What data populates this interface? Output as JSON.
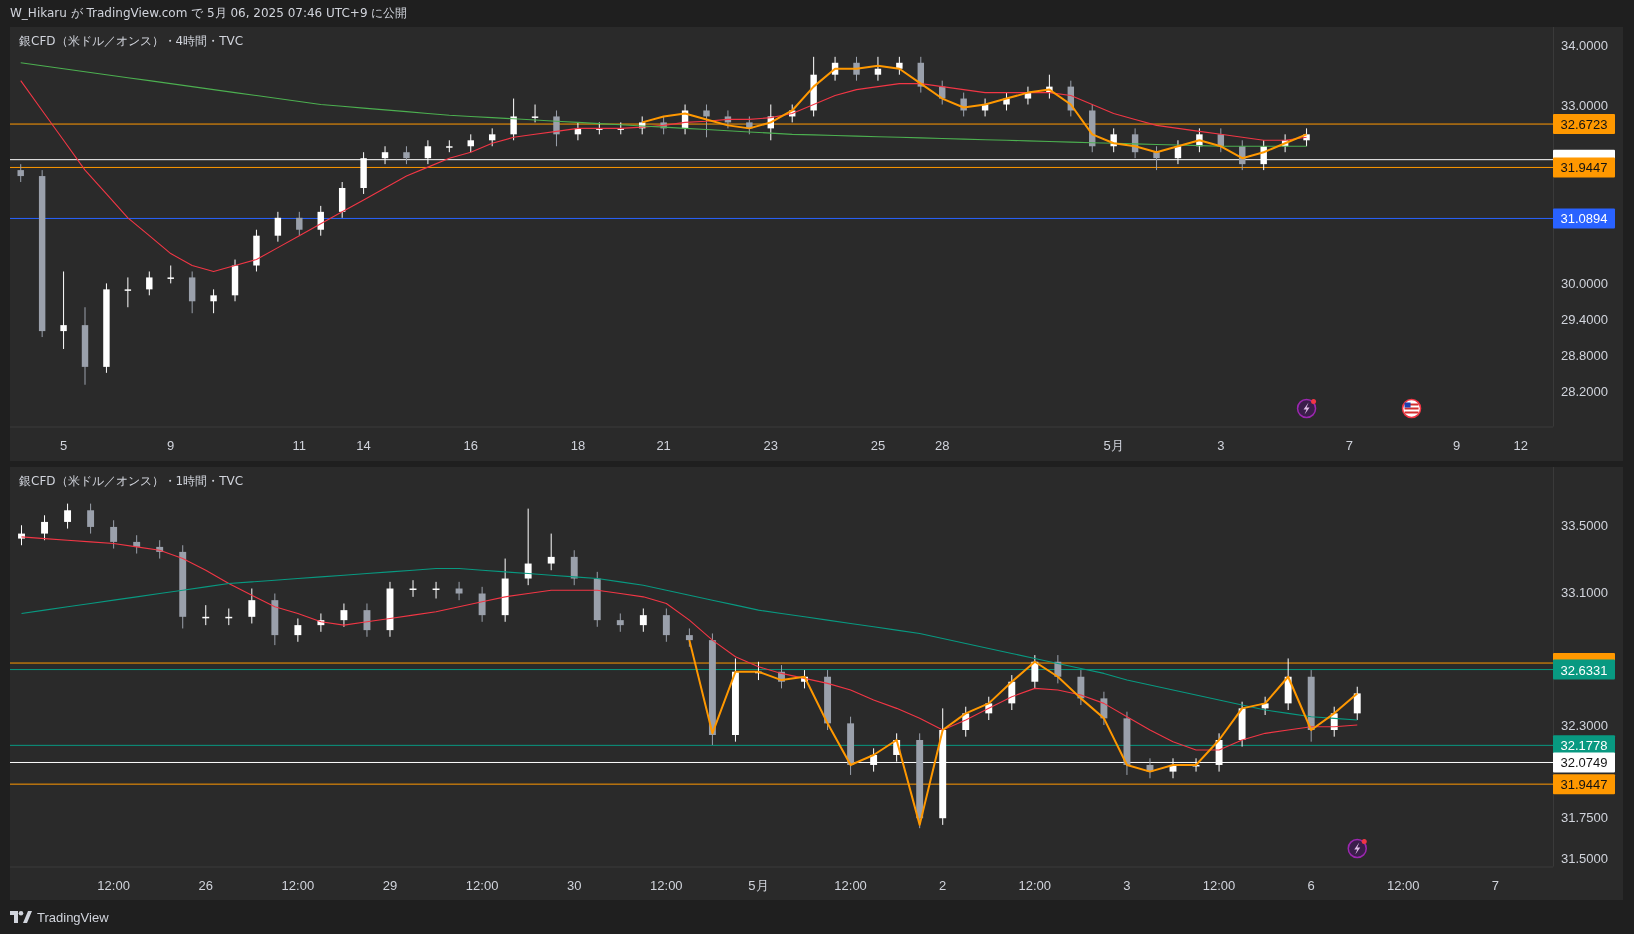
{
  "header": {
    "text": "W_Hikaru が TradingView.com で 5月 06, 2025 07:46 UTC+9 に公開"
  },
  "panels": [
    {
      "title": "銀CFD（米ドル／オンス）・4時間・TVC",
      "events": [
        {
          "kind": "lightning"
        },
        {
          "kind": "flag"
        }
      ],
      "chart_data": {
        "type": "candlestick",
        "categories": [
          null,
          null,
          "5",
          null,
          null,
          null,
          null,
          "9",
          null,
          null,
          null,
          null,
          null,
          "11",
          null,
          null,
          "14",
          null,
          null,
          null,
          null,
          "16",
          null,
          null,
          null,
          null,
          "18",
          null,
          null,
          null,
          "21",
          null,
          null,
          null,
          null,
          "23",
          null,
          null,
          null,
          null,
          "25",
          null,
          null,
          "28",
          null,
          null,
          null,
          null,
          null,
          null,
          null,
          "5月",
          null,
          null,
          null,
          null,
          "3",
          null,
          null,
          null,
          null,
          null,
          "7",
          null,
          null,
          null,
          null,
          "9",
          null,
          null,
          "12",
          null
        ],
        "ylim": [
          27.6,
          34.3
        ],
        "yticks": [
          {
            "value": 34,
            "label": "34.0000"
          },
          {
            "value": 33,
            "label": "33.0000"
          },
          {
            "value": 30,
            "label": "30.0000"
          },
          {
            "value": 29.4,
            "label": "29.4000"
          },
          {
            "value": 28.8,
            "label": "28.8000"
          },
          {
            "value": 28.2,
            "label": "28.2000"
          }
        ],
        "ohlc": [
          [
            31.9,
            32.0,
            31.7,
            31.8
          ],
          [
            31.8,
            31.9,
            29.1,
            29.2
          ],
          [
            29.2,
            30.2,
            28.9,
            29.3
          ],
          [
            29.3,
            29.6,
            28.3,
            28.6
          ],
          [
            28.6,
            30.0,
            28.5,
            29.9
          ],
          [
            29.9,
            30.1,
            29.6,
            29.9
          ],
          [
            29.9,
            30.2,
            29.8,
            30.1
          ],
          [
            30.1,
            30.3,
            30.0,
            30.1
          ],
          [
            30.1,
            30.2,
            29.5,
            29.7
          ],
          [
            29.7,
            29.9,
            29.5,
            29.8
          ],
          [
            29.8,
            30.4,
            29.7,
            30.3
          ],
          [
            30.3,
            30.9,
            30.2,
            30.8
          ],
          [
            30.8,
            31.2,
            30.7,
            31.1
          ],
          [
            31.1,
            31.2,
            30.8,
            30.9
          ],
          [
            30.9,
            31.3,
            30.8,
            31.2
          ],
          [
            31.2,
            31.7,
            31.1,
            31.6
          ],
          [
            31.6,
            32.2,
            31.5,
            32.1
          ],
          [
            32.1,
            32.3,
            32.0,
            32.2
          ],
          [
            32.2,
            32.3,
            32.0,
            32.1
          ],
          [
            32.1,
            32.4,
            32.0,
            32.3
          ],
          [
            32.3,
            32.4,
            32.2,
            32.3
          ],
          [
            32.3,
            32.5,
            32.2,
            32.4
          ],
          [
            32.4,
            32.6,
            32.3,
            32.5
          ],
          [
            32.5,
            33.1,
            32.4,
            32.8
          ],
          [
            32.8,
            33.0,
            32.7,
            32.8
          ],
          [
            32.8,
            32.9,
            32.3,
            32.5
          ],
          [
            32.5,
            32.7,
            32.4,
            32.6
          ],
          [
            32.6,
            32.7,
            32.5,
            32.6
          ],
          [
            32.6,
            32.7,
            32.5,
            32.6
          ],
          [
            32.6,
            32.8,
            32.5,
            32.7
          ],
          [
            32.7,
            32.8,
            32.5,
            32.6
          ],
          [
            32.6,
            33.0,
            32.5,
            32.9
          ],
          [
            32.9,
            33.0,
            32.45,
            32.8
          ],
          [
            32.8,
            32.9,
            32.6,
            32.7
          ],
          [
            32.7,
            32.8,
            32.5,
            32.6
          ],
          [
            32.6,
            33.0,
            32.4,
            32.8
          ],
          [
            32.8,
            33.0,
            32.7,
            32.9
          ],
          [
            32.9,
            33.8,
            32.8,
            33.5
          ],
          [
            33.5,
            33.8,
            33.4,
            33.7
          ],
          [
            33.7,
            33.8,
            33.4,
            33.5
          ],
          [
            33.5,
            33.8,
            33.4,
            33.6
          ],
          [
            33.6,
            33.8,
            33.5,
            33.7
          ],
          [
            33.7,
            33.8,
            33.2,
            33.3
          ],
          [
            33.3,
            33.4,
            33.0,
            33.1
          ],
          [
            33.1,
            33.2,
            32.8,
            32.9
          ],
          [
            32.9,
            33.1,
            32.8,
            33.0
          ],
          [
            33.0,
            33.2,
            32.9,
            33.1
          ],
          [
            33.1,
            33.3,
            33.0,
            33.2
          ],
          [
            33.2,
            33.5,
            33.1,
            33.3
          ],
          [
            33.3,
            33.4,
            32.8,
            32.9
          ],
          [
            32.9,
            33.0,
            32.2,
            32.3
          ],
          [
            32.3,
            32.6,
            32.2,
            32.5
          ],
          [
            32.5,
            32.6,
            32.1,
            32.2
          ],
          [
            32.2,
            32.3,
            31.9,
            32.1
          ],
          [
            32.1,
            32.4,
            32.0,
            32.3
          ],
          [
            32.3,
            32.6,
            32.2,
            32.5
          ],
          [
            32.5,
            32.6,
            32.2,
            32.3
          ],
          [
            32.3,
            32.4,
            31.9,
            32.0
          ],
          [
            32.0,
            32.4,
            31.9,
            32.3
          ],
          [
            32.3,
            32.5,
            32.2,
            32.4
          ],
          [
            32.4,
            32.6,
            32.3,
            32.5
          ],
          null,
          null,
          null,
          null,
          null,
          null,
          null,
          null,
          null,
          null,
          null
        ],
        "series": [
          {
            "type": "line",
            "color": "#f23645",
            "values": [
              33.4,
              32.9,
              32.4,
              31.9,
              31.5,
              31.1,
              30.8,
              30.5,
              30.3,
              30.2,
              30.3,
              30.4,
              30.6,
              30.8,
              31.0,
              31.2,
              31.4,
              31.6,
              31.8,
              31.95,
              32.1,
              32.2,
              32.35,
              32.45,
              32.5,
              32.55,
              32.6,
              32.6,
              32.6,
              32.62,
              32.65,
              32.7,
              32.72,
              32.75,
              32.75,
              32.78,
              32.85,
              33.0,
              33.15,
              33.25,
              33.3,
              33.35,
              33.35,
              33.3,
              33.25,
              33.2,
              33.2,
              33.2,
              33.2,
              33.15,
              33.0,
              32.85,
              32.75,
              32.65,
              32.6,
              32.55,
              32.5,
              32.45,
              32.4,
              32.4,
              32.45,
              null,
              null,
              null,
              null,
              null,
              null,
              null,
              null,
              null,
              null,
              null
            ]
          },
          {
            "type": "line",
            "color": "#4caf50",
            "values": [
              33.7,
              33.65,
              33.6,
              33.55,
              33.5,
              33.45,
              33.4,
              33.35,
              33.3,
              33.25,
              33.2,
              33.15,
              33.1,
              33.05,
              33.0,
              32.97,
              32.94,
              32.91,
              32.88,
              32.85,
              32.82,
              32.8,
              32.78,
              32.76,
              32.74,
              32.72,
              32.7,
              32.68,
              32.66,
              32.64,
              32.62,
              32.6,
              32.58,
              32.56,
              32.54,
              32.52,
              32.5,
              32.49,
              32.48,
              32.47,
              32.46,
              32.45,
              32.44,
              32.43,
              32.42,
              32.41,
              32.4,
              32.39,
              32.38,
              32.37,
              32.36,
              32.35,
              32.34,
              32.33,
              32.32,
              32.31,
              32.3,
              32.3,
              32.3,
              32.3,
              32.3,
              null,
              null,
              null,
              null,
              null,
              null,
              null,
              null,
              null,
              null,
              null
            ]
          },
          {
            "type": "line",
            "color": "#ff9800",
            "values": [
              null,
              null,
              null,
              null,
              null,
              null,
              null,
              null,
              null,
              null,
              null,
              null,
              null,
              null,
              null,
              null,
              null,
              null,
              null,
              null,
              null,
              null,
              null,
              null,
              null,
              null,
              null,
              null,
              null,
              32.7,
              32.8,
              32.85,
              32.75,
              32.65,
              32.6,
              32.7,
              32.9,
              33.3,
              33.6,
              33.6,
              33.65,
              33.6,
              33.35,
              33.1,
              32.95,
              33.0,
              33.1,
              33.2,
              33.25,
              33.0,
              32.5,
              32.35,
              32.3,
              32.2,
              32.3,
              32.4,
              32.3,
              32.1,
              32.2,
              32.35,
              32.5,
              null,
              null,
              null,
              null,
              null,
              null,
              null,
              null,
              null,
              null,
              null
            ]
          }
        ],
        "ref_lines": [
          {
            "axis": "y",
            "value": 32.6723,
            "label": "32.6723",
            "color": "#ff9800"
          },
          {
            "axis": "y",
            "value": 32.0749,
            "color": "#ffffff"
          },
          {
            "axis": "y",
            "value": 31.9447,
            "label": "31.9447",
            "color": "#ff9800"
          },
          {
            "axis": "y",
            "value": 31.0894,
            "label": "31.0894",
            "color": "#2962ff"
          }
        ]
      }
    },
    {
      "title": "銀CFD（米ドル／オンス）・1時間・TVC",
      "events": [
        {
          "kind": "lightning"
        }
      ],
      "chart_data": {
        "type": "candlestick",
        "categories": [
          null,
          null,
          null,
          null,
          "12:00",
          null,
          null,
          null,
          "26",
          null,
          null,
          null,
          "12:00",
          null,
          null,
          null,
          "29",
          null,
          null,
          null,
          "12:00",
          null,
          null,
          null,
          "30",
          null,
          null,
          null,
          "12:00",
          null,
          null,
          null,
          "5月",
          null,
          null,
          null,
          "12:00",
          null,
          null,
          null,
          "2",
          null,
          null,
          null,
          "12:00",
          null,
          null,
          null,
          "3",
          null,
          null,
          null,
          "12:00",
          null,
          null,
          null,
          "6",
          null,
          null,
          null,
          "12:00",
          null,
          null,
          null,
          "7",
          null,
          null
        ],
        "ylim": [
          31.45,
          33.85
        ],
        "yticks": [
          {
            "value": 33.5,
            "label": "33.5000"
          },
          {
            "value": 33.1,
            "label": "33.1000"
          },
          {
            "value": 32.3,
            "label": "32.3000"
          },
          {
            "value": 31.75,
            "label": "31.7500"
          },
          {
            "value": 31.5,
            "label": "31.5000"
          }
        ],
        "ohlc": [
          [
            33.42,
            33.5,
            33.38,
            33.45
          ],
          [
            33.45,
            33.56,
            33.41,
            33.52
          ],
          [
            33.52,
            33.63,
            33.48,
            33.59
          ],
          [
            33.59,
            33.63,
            33.45,
            33.49
          ],
          [
            33.49,
            33.53,
            33.36,
            33.4
          ],
          [
            33.4,
            33.44,
            33.33,
            33.37
          ],
          [
            33.37,
            33.41,
            33.3,
            33.34
          ],
          [
            33.34,
            33.38,
            32.88,
            32.95
          ],
          [
            32.95,
            33.02,
            32.9,
            32.95
          ],
          [
            32.95,
            33.0,
            32.9,
            32.95
          ],
          [
            32.95,
            33.12,
            32.91,
            33.05
          ],
          [
            33.05,
            33.09,
            32.78,
            32.84
          ],
          [
            32.84,
            32.94,
            32.8,
            32.9
          ],
          [
            32.9,
            32.97,
            32.86,
            32.93
          ],
          [
            32.93,
            33.03,
            32.89,
            32.99
          ],
          [
            32.99,
            33.03,
            32.83,
            32.87
          ],
          [
            32.87,
            33.16,
            32.83,
            33.12
          ],
          [
            33.12,
            33.17,
            33.07,
            33.12
          ],
          [
            33.12,
            33.16,
            33.06,
            33.12
          ],
          [
            33.12,
            33.16,
            33.05,
            33.09
          ],
          [
            33.09,
            33.13,
            32.92,
            32.96
          ],
          [
            32.96,
            33.3,
            32.92,
            33.18
          ],
          [
            33.18,
            33.6,
            33.14,
            33.27
          ],
          [
            33.27,
            33.45,
            33.23,
            33.31
          ],
          [
            33.31,
            33.35,
            33.14,
            33.18
          ],
          [
            33.18,
            33.22,
            32.89,
            32.93
          ],
          [
            32.93,
            32.97,
            32.86,
            32.9
          ],
          [
            32.9,
            33.0,
            32.86,
            32.96
          ],
          [
            32.96,
            33.0,
            32.8,
            32.84
          ],
          [
            32.84,
            32.88,
            32.77,
            32.81
          ],
          [
            32.81,
            32.85,
            32.18,
            32.24
          ],
          [
            32.24,
            32.7,
            32.2,
            32.62
          ],
          [
            32.62,
            32.68,
            32.57,
            32.62
          ],
          [
            32.62,
            32.66,
            32.52,
            32.56
          ],
          [
            32.56,
            32.63,
            32.52,
            32.59
          ],
          [
            32.59,
            32.63,
            32.27,
            32.31
          ],
          [
            32.31,
            32.35,
            32.0,
            32.06
          ],
          [
            32.06,
            32.16,
            32.02,
            32.12
          ],
          [
            32.12,
            32.25,
            32.08,
            32.21
          ],
          [
            32.21,
            32.25,
            31.68,
            31.74
          ],
          [
            31.74,
            32.4,
            31.7,
            32.27
          ],
          [
            32.27,
            32.41,
            32.23,
            32.37
          ],
          [
            32.37,
            32.47,
            32.33,
            32.43
          ],
          [
            32.43,
            32.6,
            32.39,
            32.56
          ],
          [
            32.56,
            32.72,
            32.52,
            32.68
          ],
          [
            32.68,
            32.72,
            32.55,
            32.59
          ],
          [
            32.59,
            32.63,
            32.42,
            32.46
          ],
          [
            32.46,
            32.5,
            32.3,
            32.34
          ],
          [
            32.34,
            32.38,
            32.0,
            32.06
          ],
          [
            32.06,
            32.1,
            31.98,
            32.02
          ],
          [
            32.02,
            32.1,
            31.98,
            32.06
          ],
          [
            32.06,
            32.1,
            32.02,
            32.06
          ],
          [
            32.06,
            32.25,
            32.02,
            32.21
          ],
          [
            32.21,
            32.44,
            32.17,
            32.4
          ],
          [
            32.4,
            32.47,
            32.36,
            32.43
          ],
          [
            32.43,
            32.7,
            32.39,
            32.59
          ],
          [
            32.59,
            32.63,
            32.2,
            32.27
          ],
          [
            32.27,
            32.41,
            32.23,
            32.37
          ],
          [
            32.37,
            32.53,
            32.33,
            32.49
          ],
          null,
          null,
          null,
          null,
          null,
          null,
          null,
          null
        ],
        "series": [
          {
            "type": "line",
            "color": "#f23645",
            "values": [
              33.43,
              33.42,
              33.41,
              33.4,
              33.39,
              33.37,
              33.35,
              33.3,
              33.23,
              33.15,
              33.08,
              33.01,
              32.97,
              32.92,
              32.9,
              32.92,
              32.94,
              32.96,
              32.98,
              33.01,
              33.04,
              33.07,
              33.09,
              33.11,
              33.11,
              33.11,
              33.09,
              33.07,
              33.03,
              32.93,
              32.81,
              32.71,
              32.65,
              32.61,
              32.58,
              32.55,
              32.51,
              32.45,
              32.4,
              32.34,
              32.27,
              32.33,
              32.4,
              32.47,
              32.52,
              32.51,
              32.48,
              32.43,
              32.35,
              32.27,
              32.2,
              32.15,
              32.15,
              32.21,
              32.25,
              32.27,
              32.29,
              32.29,
              32.3,
              null,
              null,
              null,
              null,
              null,
              null,
              null,
              null
            ]
          },
          {
            "type": "line",
            "color": "#089981",
            "values": [
              32.97,
              32.99,
              33.01,
              33.03,
              33.05,
              33.07,
              33.09,
              33.11,
              33.13,
              33.15,
              33.16,
              33.17,
              33.18,
              33.19,
              33.2,
              33.21,
              33.22,
              33.23,
              33.24,
              33.24,
              33.23,
              33.22,
              33.21,
              33.2,
              33.19,
              33.18,
              33.16,
              33.14,
              33.11,
              33.08,
              33.05,
              33.02,
              32.99,
              32.97,
              32.95,
              32.93,
              32.91,
              32.89,
              32.87,
              32.85,
              32.82,
              32.79,
              32.76,
              32.73,
              32.7,
              32.67,
              32.64,
              32.61,
              32.57,
              32.54,
              32.51,
              32.48,
              32.45,
              32.42,
              32.39,
              32.37,
              32.35,
              32.34,
              32.33,
              null,
              null,
              null,
              null,
              null,
              null,
              null,
              null
            ]
          },
          {
            "type": "line",
            "color": "#ff9800",
            "values": [
              null,
              null,
              null,
              null,
              null,
              null,
              null,
              null,
              null,
              null,
              null,
              null,
              null,
              null,
              null,
              null,
              null,
              null,
              null,
              null,
              null,
              null,
              null,
              null,
              null,
              null,
              null,
              null,
              null,
              32.81,
              32.25,
              32.62,
              32.62,
              32.57,
              32.59,
              32.31,
              32.06,
              32.12,
              32.21,
              31.7,
              32.27,
              32.37,
              32.43,
              32.56,
              32.68,
              32.59,
              32.46,
              32.34,
              32.06,
              32.02,
              32.06,
              32.06,
              32.21,
              32.4,
              32.43,
              32.59,
              32.27,
              32.37,
              32.49,
              null,
              null,
              null,
              null,
              null,
              null,
              null,
              null
            ]
          }
        ],
        "ref_lines": [
          {
            "axis": "y",
            "value": 32.6723,
            "color": "#ff9800"
          },
          {
            "axis": "y",
            "value": 32.6331,
            "label": "32.6331",
            "color": "#089981"
          },
          {
            "axis": "y",
            "value": 32.1778,
            "label": "32.1778",
            "color": "#089981"
          },
          {
            "axis": "y",
            "value": 32.0749,
            "label": "32.0749",
            "color": "#ffffff"
          },
          {
            "axis": "y",
            "value": 31.9447,
            "label": "31.9447",
            "color": "#ff9800"
          }
        ]
      }
    }
  ],
  "footer": {
    "brand": "TradingView"
  }
}
